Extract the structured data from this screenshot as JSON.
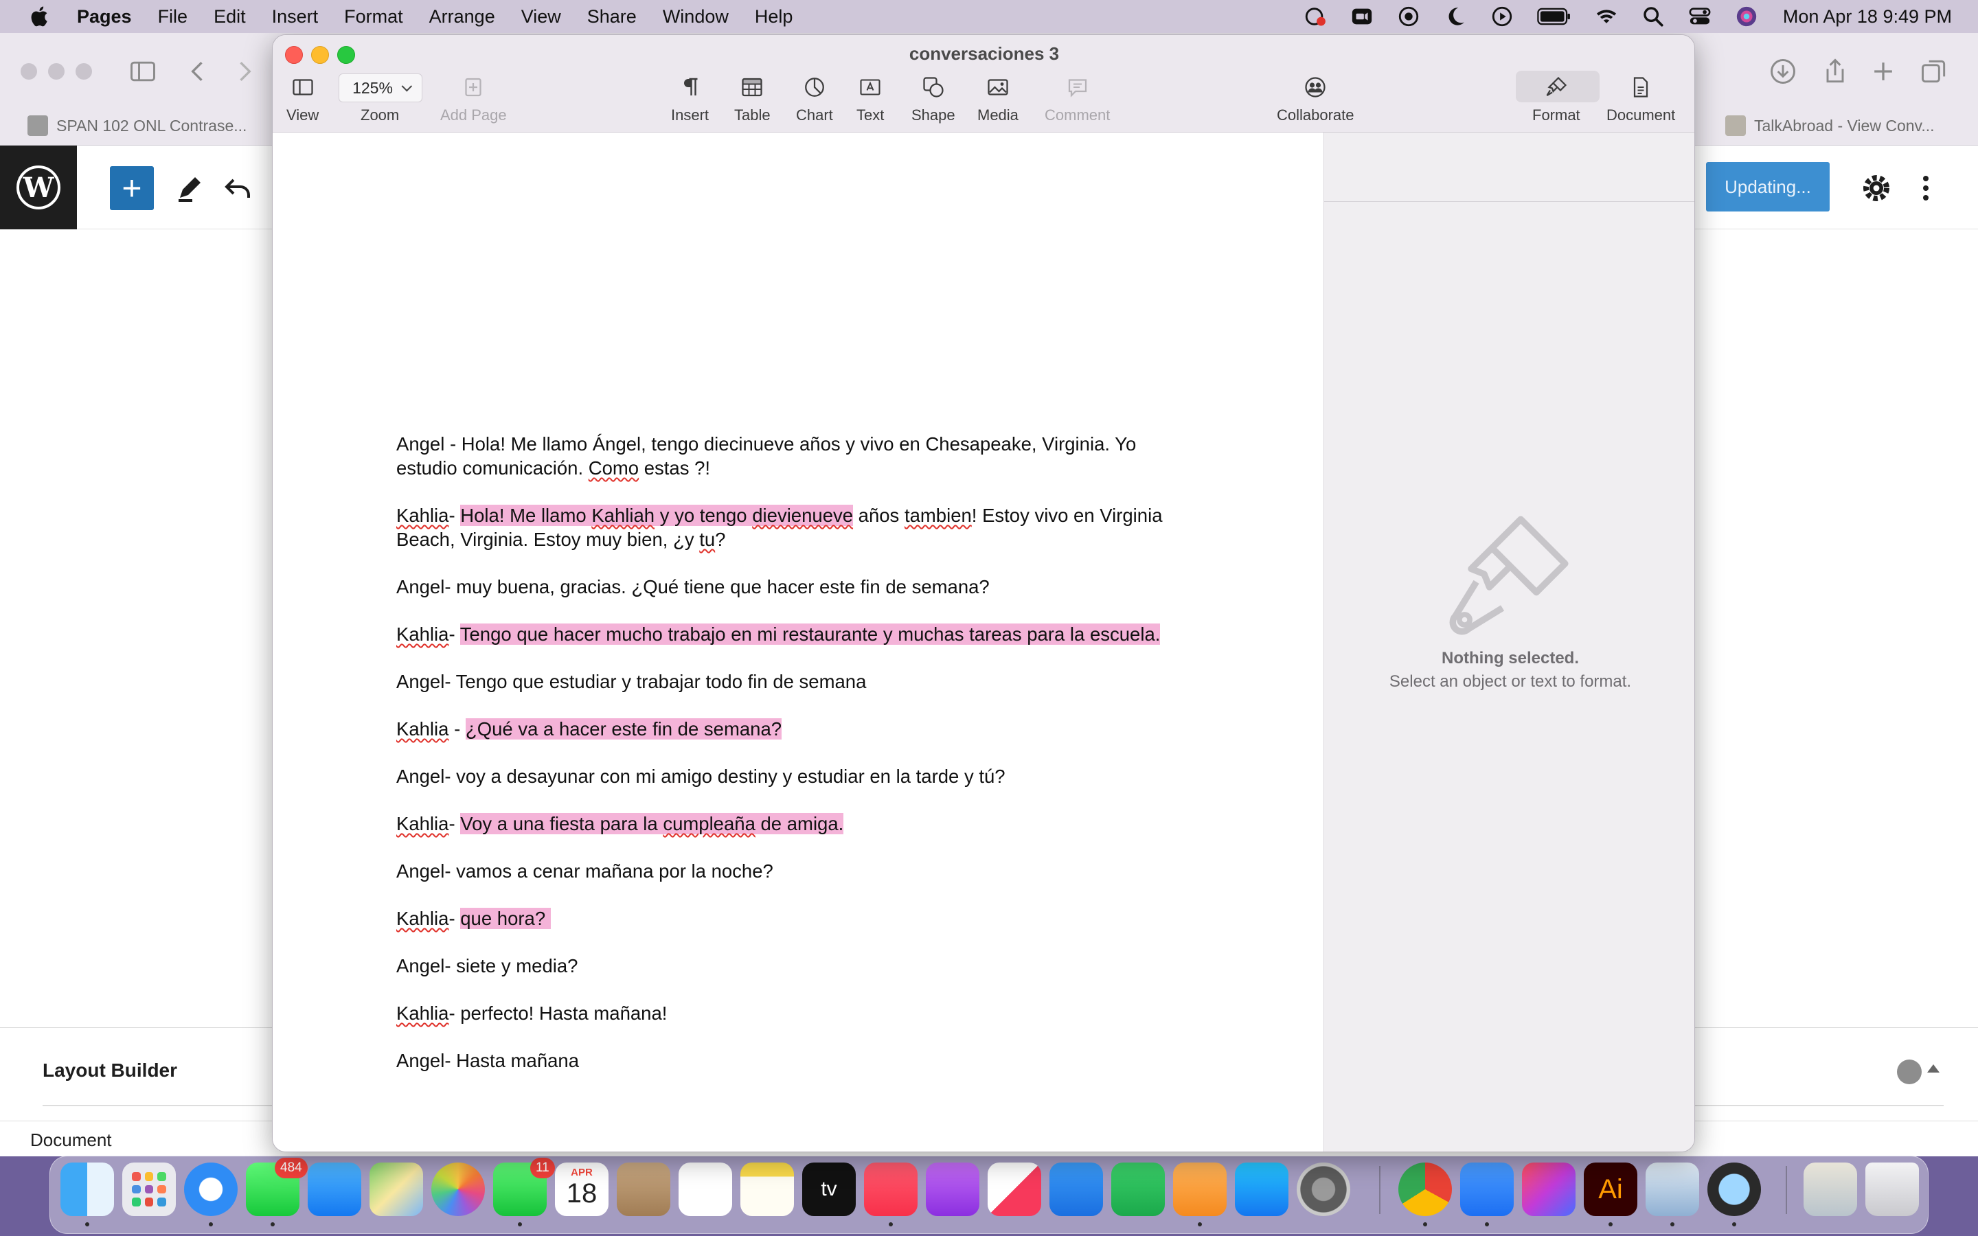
{
  "menubar": {
    "app": "Pages",
    "items": [
      "File",
      "Edit",
      "Insert",
      "Format",
      "Arrange",
      "View",
      "Share",
      "Window",
      "Help"
    ],
    "clock": "Mon Apr 18  9:49 PM"
  },
  "browser": {
    "tabs": [
      "SPAN 102 ONL Contrase...",
      "TalkAbroad - View Conv..."
    ],
    "update_button": "Updating...",
    "layout_builder": "Layout Builder",
    "status": "Document"
  },
  "pages": {
    "title": "conversaciones 3",
    "zoom": "125%",
    "toolbar": {
      "view": "View",
      "zoom": "Zoom",
      "add_page": "Add Page",
      "insert": "Insert",
      "table": "Table",
      "chart": "Chart",
      "text": "Text",
      "shape": "Shape",
      "media": "Media",
      "comment": "Comment",
      "collaborate": "Collaborate",
      "format": "Format",
      "document": "Document"
    },
    "sidebar": {
      "nothing_selected": "Nothing selected.",
      "hint": "Select an object or text to format."
    }
  },
  "document": {
    "p1a": "Angel - Hola! Me llamo Ángel, tengo diecinueve años y vivo en Chesapeake, Virginia. Yo",
    "p1b_pre": "estudio comunicación. ",
    "p1b_sq": "Como",
    "p1b_post": " estas ?!",
    "p2_name": "Kahlia",
    "p2_dash": "- ",
    "p2_hl1": "Hola! Me llamo ",
    "p2_hl_sq1": "Kahliah",
    "p2_hl2": " y yo tengo ",
    "p2_hl_sq2": "dievienueve",
    "p2_after": " años ",
    "p2_sq3": "tambien",
    "p2_end": "! Estoy vivo en Virginia",
    "p2b_pre": "Beach, Virginia. Estoy muy bien, ¿y ",
    "p2b_sq": "tu",
    "p2b_post": "?",
    "p3": "Angel- muy buena, gracias. ¿Qué tiene que hacer este fin de semana?",
    "p4_dash": "- ",
    "p4_hl": "Tengo que hacer mucho trabajo en mi restaurante y muchas tareas para la escuela.",
    "p5": "Angel- Tengo que estudiar y trabajar todo fin de semana",
    "p6_dash": " - ",
    "p6_hl": "¿Qué va a hacer este fin de semana?",
    "p7": "Angel- voy a desayunar con mi amigo destiny y estudiar en la tarde y tú?",
    "p8_dash": "- ",
    "p8_hl1": "Voy a una fiesta para la ",
    "p8_hl_sq": "cumpleaña",
    "p8_hl2": " de amiga.",
    "p9": "Angel- vamos a cenar mañana por la noche?",
    "p10_dash": "- ",
    "p10_hl": "que hora? ",
    "p11": "Angel- siete y media?",
    "p12_dash": "- perfecto! Hasta mañana!",
    "p13": "Angel- Hasta mañana"
  },
  "dock": {
    "messages_badge": "484",
    "facetime_badge": "11",
    "calendar_month": "APR",
    "calendar_day": "18",
    "tv_label": "tv",
    "illustrator_label": "Ai"
  }
}
